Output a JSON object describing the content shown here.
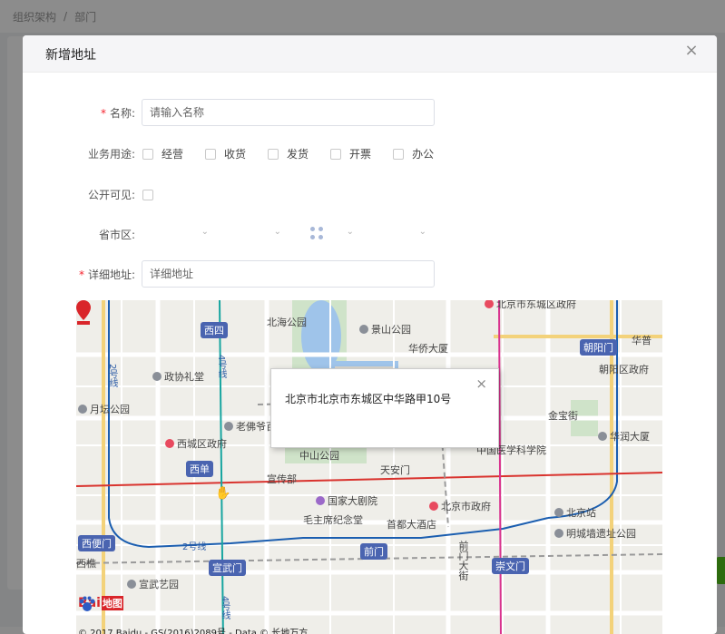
{
  "breadcrumb": [
    "组织架构",
    "部门"
  ],
  "modal": {
    "title": "新增地址",
    "close_symbol": "×"
  },
  "form": {
    "name_label": "名称:",
    "name_placeholder": "请输入名称",
    "usage_label": "业务用途:",
    "usage_options": [
      "经营",
      "收货",
      "发货",
      "开票",
      "办公"
    ],
    "public_label": "公开可见:",
    "region_label": "省市区:",
    "address_label": "详细地址:",
    "address_placeholder": "详细地址",
    "required_mark": "*"
  },
  "map": {
    "info_text": "北京市北京市东城区中华路甲10号",
    "info_close": "×",
    "stations": [
      "西四",
      "西单",
      "朝阳门",
      "西便门",
      "宣武门",
      "前门",
      "崇文门"
    ],
    "pois": [
      "北海公园",
      "景山公园",
      "华侨大厦",
      "政协礼堂",
      "月坛公园",
      "老佛爷百",
      "西城区政府",
      "中山公园",
      "天安门",
      "中国医学科学院",
      "宣传部",
      "国家大剧院",
      "北京市政府",
      "毛主席纪念堂",
      "首都大酒店",
      "北京站",
      "明城墙遗址公园",
      "宣武艺园",
      "朝阳区政府",
      "华润大厦",
      "金宝街",
      "北京市东城区政府",
      "华普"
    ],
    "streets": [
      "前门大街",
      "西樵"
    ],
    "line_labels": [
      "4号线",
      "2号线",
      "2号线",
      "4号线"
    ],
    "logo_text_a": "Bai",
    "logo_text_b": "地图",
    "copyright": "© 2017 Baidu - GS(2016)2089号 - Data © 长地万方"
  },
  "colors": {
    "required": "#f5222d",
    "station": "#4a64b0",
    "subway_blue": "#2a64b0",
    "marker_red": "#d9252a"
  }
}
